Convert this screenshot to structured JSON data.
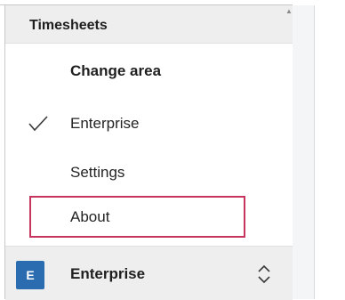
{
  "header": {
    "title": "Timesheets"
  },
  "menu": {
    "title": "Change area",
    "items": [
      {
        "label": "Enterprise",
        "checked": true
      },
      {
        "label": "Settings"
      },
      {
        "label": "About"
      }
    ]
  },
  "footer": {
    "avatar_letter": "E",
    "label": "Enterprise"
  },
  "icons": {
    "check": "checkmark-icon",
    "switcher": "chevron-up-down-icon"
  },
  "colors": {
    "focus_border": "#c7355f",
    "avatar_bg": "#2b6cb0",
    "header_bg": "#eeeeee"
  }
}
